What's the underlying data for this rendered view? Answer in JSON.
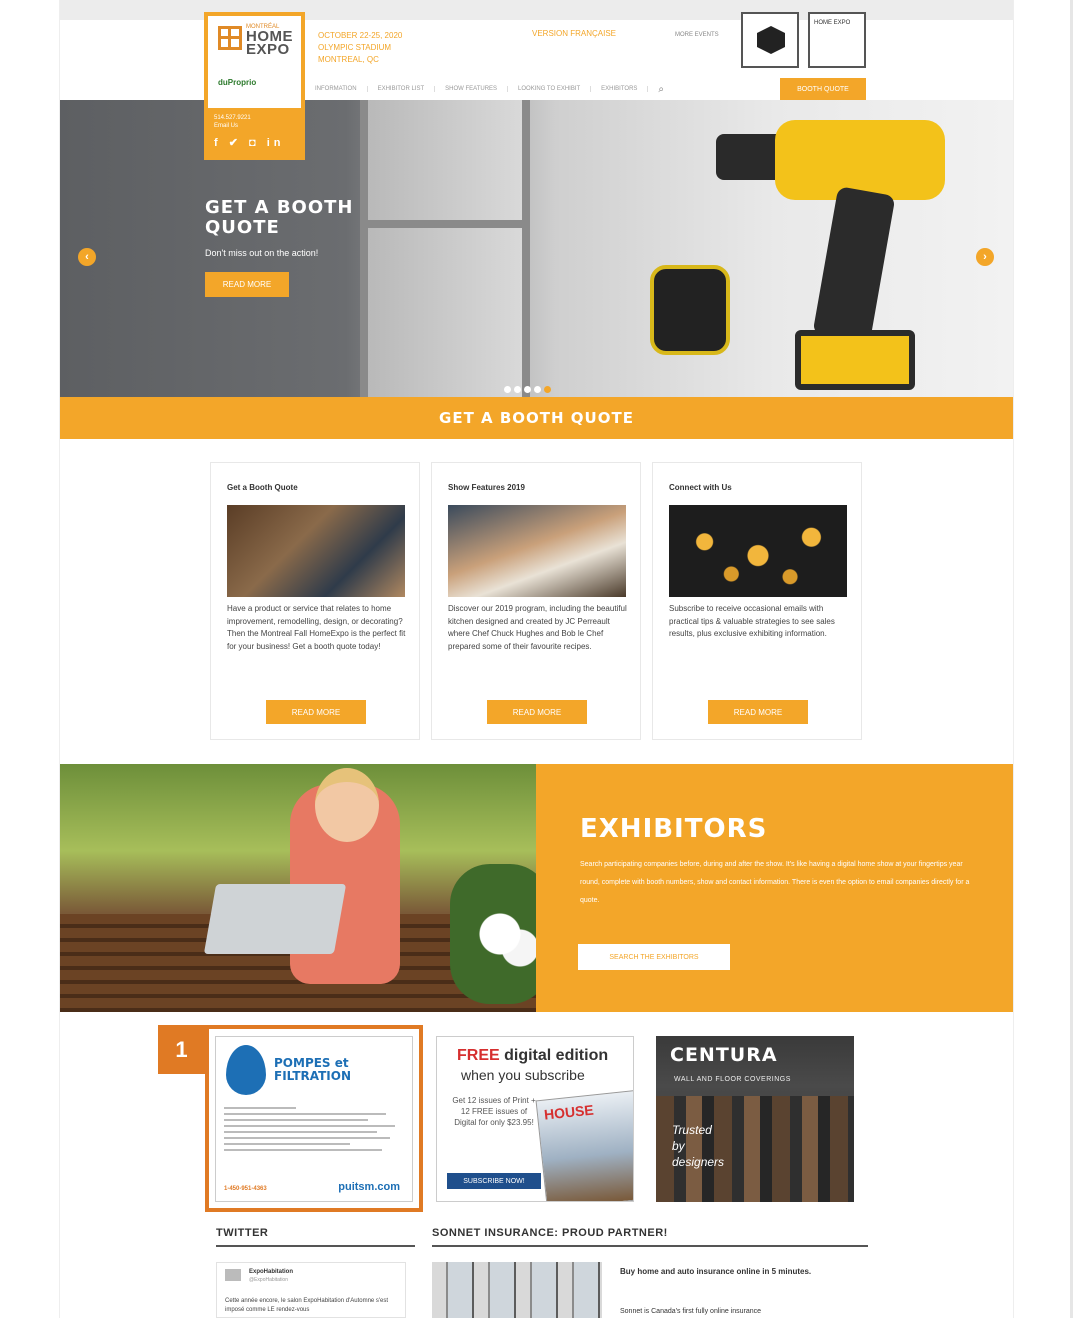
{
  "brand": {
    "logo_small": "MONTRÉAL",
    "logo_line1": "HOME",
    "logo_line2": "EXPO",
    "sponsor": "duProprio",
    "phone": "514.527.9221",
    "email_label": "Email Us",
    "social_icons": [
      "facebook-icon",
      "twitter-icon",
      "instagram-icon",
      "linkedin-icon"
    ],
    "social_glyphs": "f ✔ ◘ in"
  },
  "event": {
    "dates": "OCTOBER 22-25, 2020",
    "venue": "OLYMPIC STADIUM",
    "city": "MONTREAL, QC"
  },
  "header": {
    "language_link": "VERSION FRANÇAISE",
    "more_events": "MORE EVENTS",
    "badge_two_label": "HOME EXPO"
  },
  "nav": {
    "items": [
      "INFORMATION",
      "EXHIBITOR LIST",
      "SHOW FEATURES",
      "LOOKING TO EXHIBIT",
      "EXHIBITORS"
    ],
    "search_icon": "search-icon",
    "quote_button": "BOOTH QUOTE"
  },
  "hero": {
    "title_line1": "GET A BOOTH",
    "title_line2": "QUOTE",
    "subtitle": "Don't miss out on the action!",
    "button": "READ MORE",
    "prev_arrow": "‹",
    "next_arrow": "›",
    "slide_count": 5,
    "active_slide": 5
  },
  "quote_bar": {
    "label": "GET A BOOTH QUOTE"
  },
  "cards": [
    {
      "title": "Get a Booth Quote",
      "text": "Have a product or service that relates to home improvement, remodelling, design, or decorating? Then the Montreal Fall HomeExpo is the perfect fit for your business! Get a booth quote today!",
      "button": "READ MORE"
    },
    {
      "title": "Show Features 2019",
      "text": "Discover our 2019 program, including the beautiful kitchen designed and created by JC Perreault where Chef Chuck Hughes and Bob le Chef prepared some of their favourite recipes.",
      "button": "READ MORE"
    },
    {
      "title": "Connect with Us",
      "text": "Subscribe to receive occasional emails with practical tips & valuable strategies to see sales results, plus exclusive exhibiting information.",
      "button": "READ MORE"
    }
  ],
  "exhibitors": {
    "title": "EXHIBITORS",
    "text": "Search participating companies before, during and after the show. It's like having a digital home show at your fingertips year round, complete with booth numbers, show and contact information. There is even the option to email companies directly for a quote.",
    "button": "SEARCH THE EXHIBITORS"
  },
  "ads": {
    "marker": "1",
    "pumps": {
      "title_line1": "POMPES et",
      "title_line2": "FILTRATION",
      "phone": "1-450-951-4363",
      "url": "puitsm.com"
    },
    "magazine": {
      "free": "FREE",
      "headline_rest": " digital edition",
      "subline": "when you subscribe",
      "offer": "Get 12 issues of Print + 12 FREE issues of Digital for only $23.95!",
      "cover_title": "HOUSE",
      "button": "SUBSCRIBE NOW!"
    },
    "centura": {
      "brand": "CENTURA",
      "subtitle": "WALL AND FLOOR COVERINGS",
      "tagline_line1": "Trusted",
      "tagline_line2": "by",
      "tagline_line3": "designers"
    }
  },
  "twitter": {
    "heading": "TWITTER",
    "account_name": "ExpoHabitation",
    "account_handle": "@ExpoHabitation",
    "tweet_text": "Cette année encore, le salon ExpoHabitation d'Automne s'est imposé comme LE rendez-vous"
  },
  "sonnet": {
    "heading": "SONNET INSURANCE: PROUD PARTNER!",
    "headline": "Buy home and auto insurance online in 5 minutes.",
    "body": "Sonnet is Canada's first fully online insurance"
  },
  "colors": {
    "accent": "#f3a629",
    "highlight": "#e07a24"
  }
}
